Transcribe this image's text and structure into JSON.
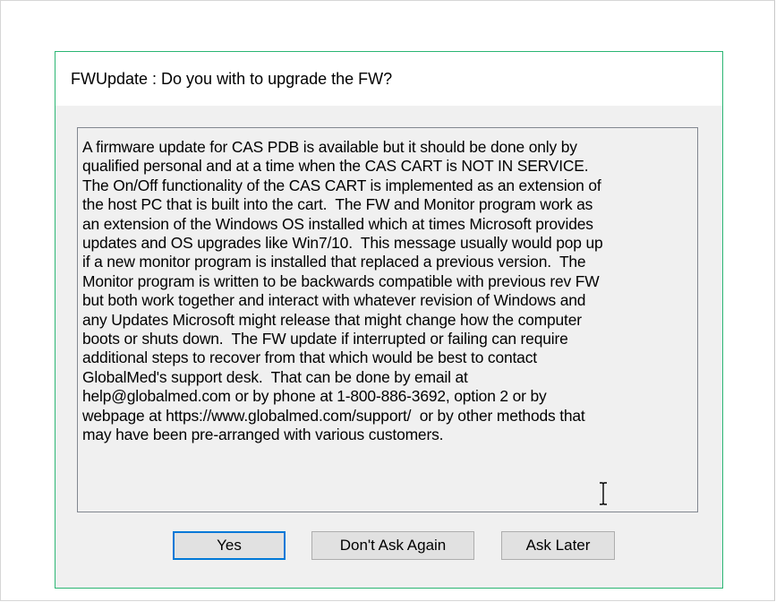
{
  "dialog": {
    "title": "FWUpdate : Do you with to upgrade the FW?",
    "message": "A firmware update for CAS PDB is available but it should be done only by\nqualified personal and at a time when the CAS CART is NOT IN SERVICE.\nThe On/Off functionality of the CAS CART is implemented as an extension of\nthe host PC that is built into the cart.  The FW and Monitor program work as\nan extension of the Windows OS installed which at times Microsoft provides\nupdates and OS upgrades like Win7/10.  This message usually would pop up\nif a new monitor program is installed that replaced a previous version.  The\nMonitor program is written to be backwards compatible with previous rev FW\nbut both work together and interact with whatever revision of Windows and\nany Updates Microsoft might release that might change how the computer\nboots or shuts down.  The FW update if interrupted or failing can require\nadditional steps to recover from that which would be best to contact\nGlobalMed's support desk.  That can be done by email at\nhelp@globalmed.com or by phone at 1-800-886-3692, option 2 or by\nwebpage at https://www.globalmed.com/support/  or by other methods that\nmay have been pre-arranged with various customers.",
    "buttons": {
      "yes": "Yes",
      "dont_ask_again": "Don't Ask Again",
      "ask_later": "Ask Later"
    },
    "default_button": "yes",
    "colors": {
      "dialog_border": "#2bb673",
      "default_button_border": "#0078d7",
      "button_face": "#e1e1e1",
      "body_background": "#f0f0f0"
    },
    "cursor_icon": "text-ibeam-cursor-icon"
  }
}
